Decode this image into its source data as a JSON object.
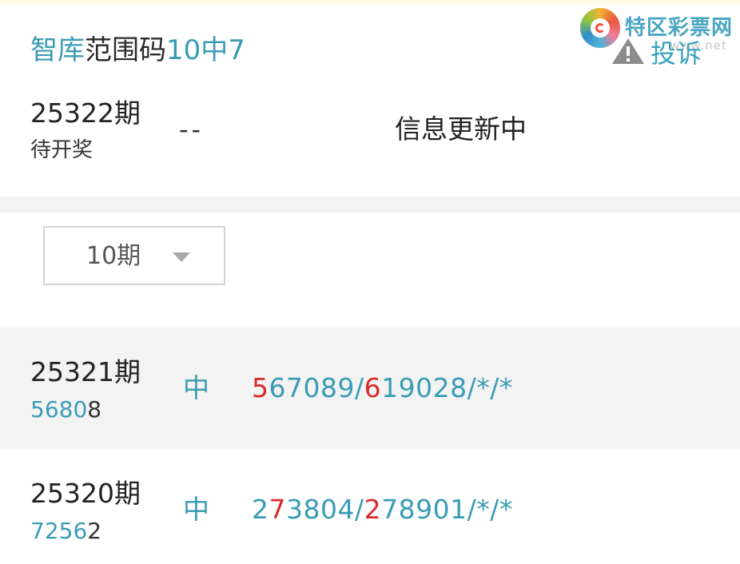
{
  "header": {
    "title_part1": "智库",
    "title_part2": "范围码",
    "title_part3": "10中7"
  },
  "brand": {
    "name": "特区彩票网",
    "url": "www.net",
    "report_label": "投诉",
    "logo_icon": "swirl-logo-icon",
    "warn_icon": "warning-triangle-icon"
  },
  "current": {
    "issue": "25322期",
    "status": "待开奖",
    "dash": "--",
    "info": "信息更新中"
  },
  "filter": {
    "selected": "10期",
    "icon": "caret-down-icon"
  },
  "rows": [
    {
      "issue": "25321期",
      "draw_hit": "5680",
      "draw_rest": "8",
      "hit_label": "中",
      "pred": [
        {
          "text": "5",
          "hl": true
        },
        {
          "text": "67089/",
          "hl": false
        },
        {
          "text": "6",
          "hl": true
        },
        {
          "text": "19028/*/*",
          "hl": false
        }
      ]
    },
    {
      "issue": "25320期",
      "draw_hit": "7256",
      "draw_rest": "2",
      "hit_label": "中",
      "pred": [
        {
          "text": "2",
          "hl": false
        },
        {
          "text": "7",
          "hl": true
        },
        {
          "text": "3804/",
          "hl": false
        },
        {
          "text": "2",
          "hl": true
        },
        {
          "text": "78901/*/*",
          "hl": false
        }
      ]
    }
  ],
  "colors": {
    "accent": "#3a9cb4",
    "highlight": "#d92b2b",
    "band": "#f3f3f3"
  }
}
